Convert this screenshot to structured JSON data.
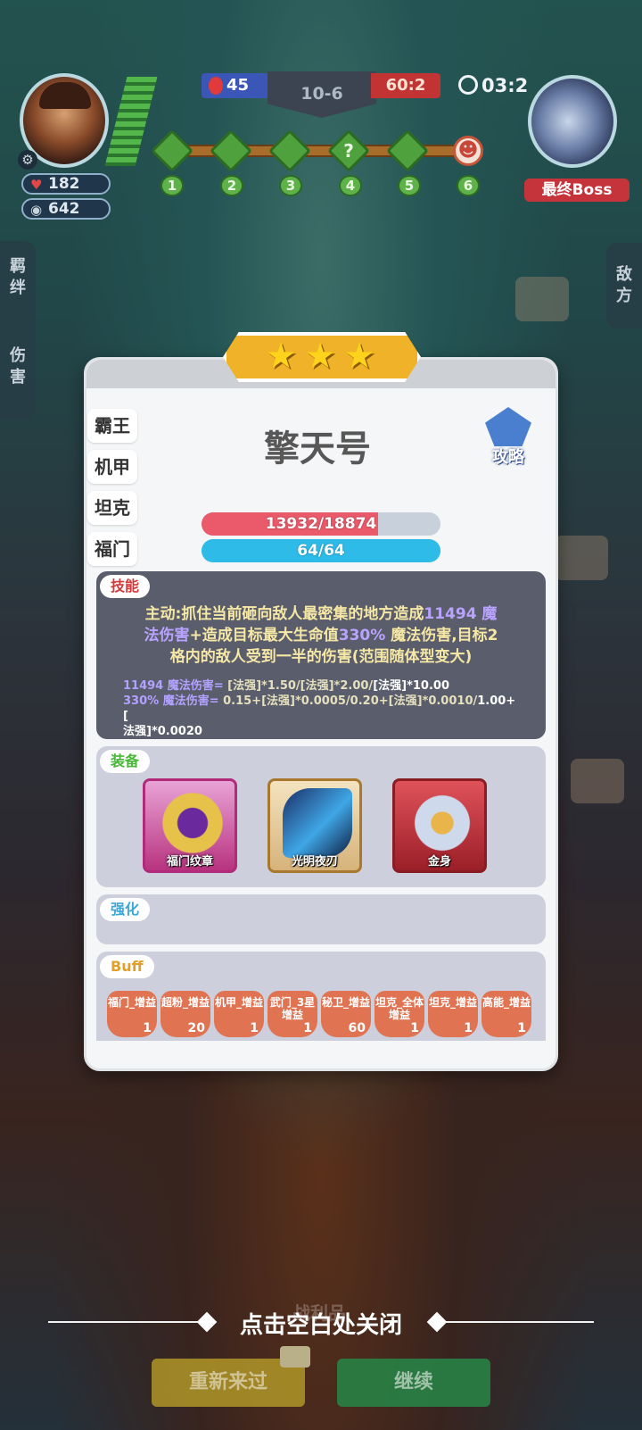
{
  "hud": {
    "player_hp": "182",
    "player_gold": "642",
    "score_left": "45",
    "round": "10-6",
    "score_right": "60:2",
    "timer": "03:2",
    "boss_label": "最终Boss",
    "stage_nodes": [
      "1",
      "2",
      "3",
      "4",
      "5",
      "6"
    ]
  },
  "side_left": {
    "bonds": [
      "羁",
      "绊"
    ],
    "damage": [
      "伤",
      "害"
    ]
  },
  "side_right": {
    "enemy": [
      "敌",
      "方"
    ]
  },
  "modal": {
    "stars": 3,
    "tabs": [
      "霸王",
      "机甲",
      "坦克",
      "福门"
    ],
    "hero_name": "擎天号",
    "guide_label": "攻略",
    "hp_text": "13932/18874",
    "hp_fraction": 0.738,
    "mana_text": "64/64",
    "mana_fraction": 1.0,
    "skill_tag": "技能",
    "skill_lines": [
      {
        "pre": "主动:抓住当前砸向敌人最密集的地方造成",
        "hl": "11494 魔",
        "post": ""
      },
      {
        "pre": "",
        "hl": "法伤害",
        "post": "+造成目标最大生命值"
      },
      {
        "pre": "",
        "hl": "330%",
        "post": " 魔法伤害,目标2"
      },
      {
        "pre": "格内的敌人受到一半的伤害(范围随体型变大)",
        "hl": "",
        "post": ""
      }
    ],
    "formula_1": {
      "p": "11494 魔法伤害= ",
      "a": "[法强]*1.50/[法强]*2.00/",
      "b": "[法强]*10.00"
    },
    "formula_2": {
      "p": "330% 魔法伤害= ",
      "a": "0.15+[法强]*0.0005/0.20+[法强]*0.0010/",
      "b": "1.00+["
    },
    "formula_3": "法强]*0.0020",
    "equip_tag": "装备",
    "equipment": [
      "福门纹章",
      "光明夜刃",
      "金身"
    ],
    "enhance_tag": "强化",
    "buff_tag": "Buff",
    "buffs": [
      {
        "name": "福门_增益",
        "val": "1"
      },
      {
        "name": "超粉_增益",
        "val": "20"
      },
      {
        "name": "机甲_增益",
        "val": "1"
      },
      {
        "name": "武门_3星增益",
        "val": "1"
      },
      {
        "name": "秘卫_增益",
        "val": "60"
      },
      {
        "name": "坦克_全体增益",
        "val": "1"
      },
      {
        "name": "坦克_增益",
        "val": "1"
      },
      {
        "name": "高能_增益",
        "val": "1"
      }
    ]
  },
  "bottom": {
    "close_hint": "点击空白处关闭",
    "loot_label": "战利品",
    "retry": "重新来过",
    "continue": "继续"
  },
  "colors": {
    "hp": "#ea5a6a",
    "mana": "#2fbbe8",
    "skill_panel": "#5a5d6b",
    "panel": "#cdd0dc"
  }
}
